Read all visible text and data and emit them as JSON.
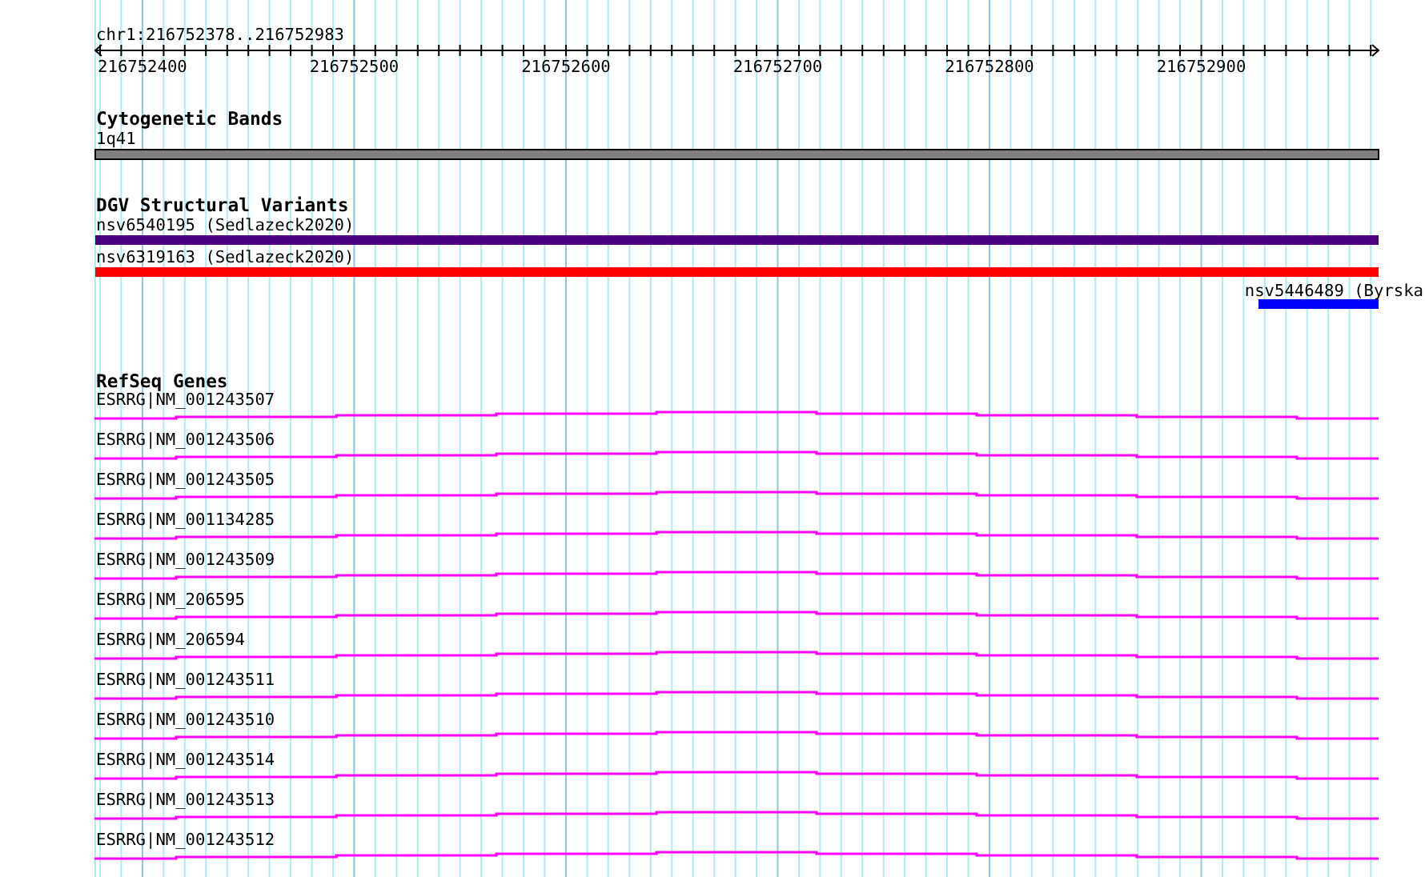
{
  "ruler": {
    "title": "chr1:216752378..216752983",
    "labels": [
      "216752400",
      "216752500",
      "216752600",
      "216752700",
      "216752800",
      "216752900"
    ]
  },
  "tracks": [
    {
      "kind": "bands",
      "title": "Cytogenetic Bands",
      "features": [
        {
          "label": "1q41"
        }
      ]
    },
    {
      "kind": "variants",
      "title": "DGV Structural Variants",
      "features": [
        {
          "label": "nsv6540195 (Sedlazeck2020)",
          "color": "#4b0082",
          "kind": "spanning"
        },
        {
          "label": "nsv6319163 (Sedlazeck2020)",
          "color": "#ff0000",
          "kind": "spanning"
        },
        {
          "label": "nsv5446489 (Byrska",
          "color": "#0000ff",
          "kind": "partial"
        }
      ]
    },
    {
      "kind": "genes",
      "title": "RefSeq Genes",
      "features": [
        {
          "label": "ESRRG|NM_001243507"
        },
        {
          "label": "ESRRG|NM_001243506"
        },
        {
          "label": "ESRRG|NM_001243505"
        },
        {
          "label": "ESRRG|NM_001134285"
        },
        {
          "label": "ESRRG|NM_001243509"
        },
        {
          "label": "ESRRG|NM_206595"
        },
        {
          "label": "ESRRG|NM_206594"
        },
        {
          "label": "ESRRG|NM_001243511"
        },
        {
          "label": "ESRRG|NM_001243510"
        },
        {
          "label": "ESRRG|NM_001243514"
        },
        {
          "label": "ESRRG|NM_001243513"
        },
        {
          "label": "ESRRG|NM_001243512"
        }
      ]
    }
  ]
}
